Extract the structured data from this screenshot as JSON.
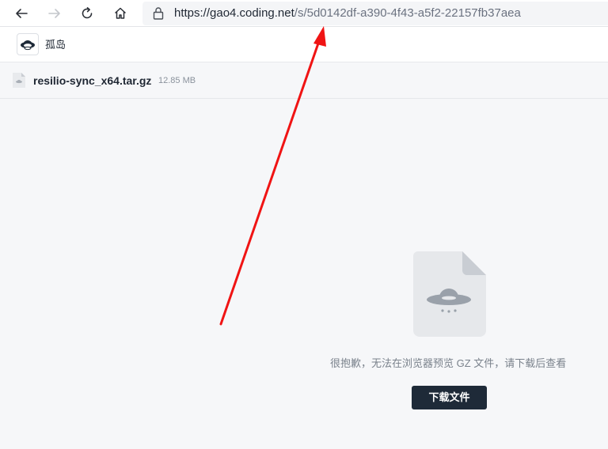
{
  "browser": {
    "url_host": "https://gao4.coding.net",
    "url_path": "/s/5d0142df-a390-4f43-a5f2-22157fb37aea",
    "back_icon": "arrow-left-icon",
    "forward_icon": "arrow-right-icon",
    "reload_icon": "reload-icon",
    "home_icon": "home-icon",
    "lock_icon": "lock-icon"
  },
  "header": {
    "user_name": "孤岛",
    "avatar_icon": "avatar-icon"
  },
  "file": {
    "name": "resilio-sync_x64.tar.gz",
    "size": "12.85 MB",
    "icon": "archive-file-icon"
  },
  "preview": {
    "message": "很抱歉，无法在浏览器预览 GZ 文件，请下载后查看",
    "download_label": "下载文件",
    "icon": "ufo-file-icon"
  },
  "colors": {
    "annotation_arrow": "#f01414",
    "button_bg": "#1e2a38",
    "page_bg": "#f6f7f9"
  }
}
